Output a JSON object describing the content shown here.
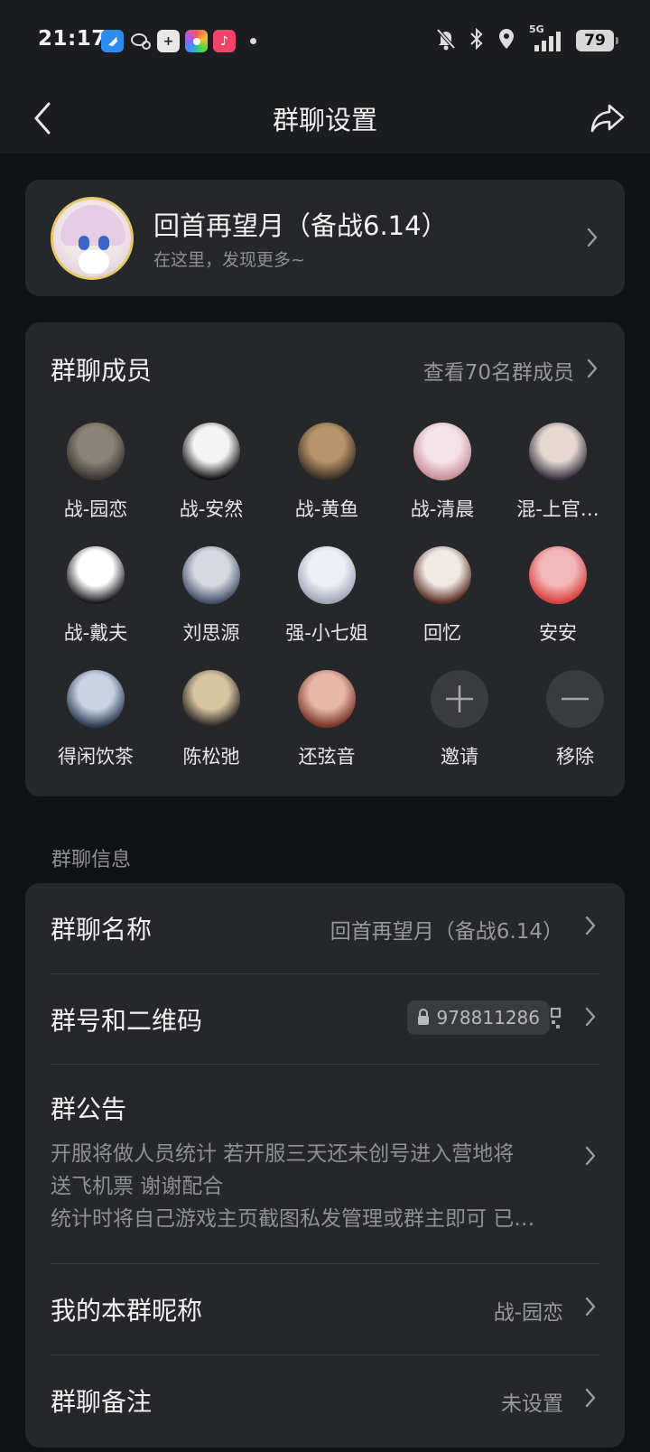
{
  "status_bar": {
    "time": "21:17",
    "signal_label": "5G",
    "battery": "79",
    "apps": [
      "blue-app-icon",
      "chat-icon",
      "plus-box-icon",
      "colorful-app-icon",
      "music-icon"
    ]
  },
  "header": {
    "title": "群聊设置"
  },
  "group": {
    "name": "回首再望月（备战6.14）",
    "subtitle": "在这里，发现更多~"
  },
  "members": {
    "title": "群聊成员",
    "view_all": "查看70名群成员",
    "items": [
      {
        "name": "战-园恋",
        "colors": [
          "#8c8376",
          "#3b3632"
        ]
      },
      {
        "name": "战-安然",
        "colors": [
          "#f4f4f4",
          "#111111"
        ]
      },
      {
        "name": "战-黄鱼",
        "colors": [
          "#b7946a",
          "#3b2f26"
        ]
      },
      {
        "name": "战-清晨",
        "colors": [
          "#f6e3ea",
          "#c98f98"
        ]
      },
      {
        "name": "混-上官…",
        "colors": [
          "#e4d8cf",
          "#3a3245"
        ]
      },
      {
        "name": "战-戴夫",
        "colors": [
          "#ffffff",
          "#1b1b1f"
        ]
      },
      {
        "name": "刘思源",
        "colors": [
          "#d6d9e2",
          "#44506a"
        ]
      },
      {
        "name": "强-小七姐",
        "colors": [
          "#eef0f5",
          "#9ea6b8"
        ]
      },
      {
        "name": "回忆",
        "colors": [
          "#f0eae3",
          "#5b2e25"
        ]
      },
      {
        "name": "安安",
        "colors": [
          "#f2b8b8",
          "#d93f3f"
        ]
      },
      {
        "name": "得闲饮茶",
        "colors": [
          "#c7d4e4",
          "#2d3b55"
        ]
      },
      {
        "name": "陈松弛",
        "colors": [
          "#d7c4a1",
          "#2a2321"
        ]
      },
      {
        "name": "还弦音",
        "colors": [
          "#e7b7a7",
          "#7a3526"
        ]
      }
    ],
    "invite_label": "邀请",
    "remove_label": "移除"
  },
  "info": {
    "section_title": "群聊信息",
    "name_label": "群聊名称",
    "name_value": "回首再望月（备战6.14）",
    "id_label": "群号和二维码",
    "id_value": "978811286",
    "notice_label": "群公告",
    "notice_lines": [
      "开服将做人员统计 若开服三天还未创号进入营地将",
      "送飞机票 谢谢配合",
      "统计时将自己游戏主页截图私发管理或群主即可 已…"
    ],
    "nickname_label": "我的本群昵称",
    "nickname_value": "战-园恋",
    "remark_label": "群聊备注",
    "remark_value": "未设置"
  }
}
